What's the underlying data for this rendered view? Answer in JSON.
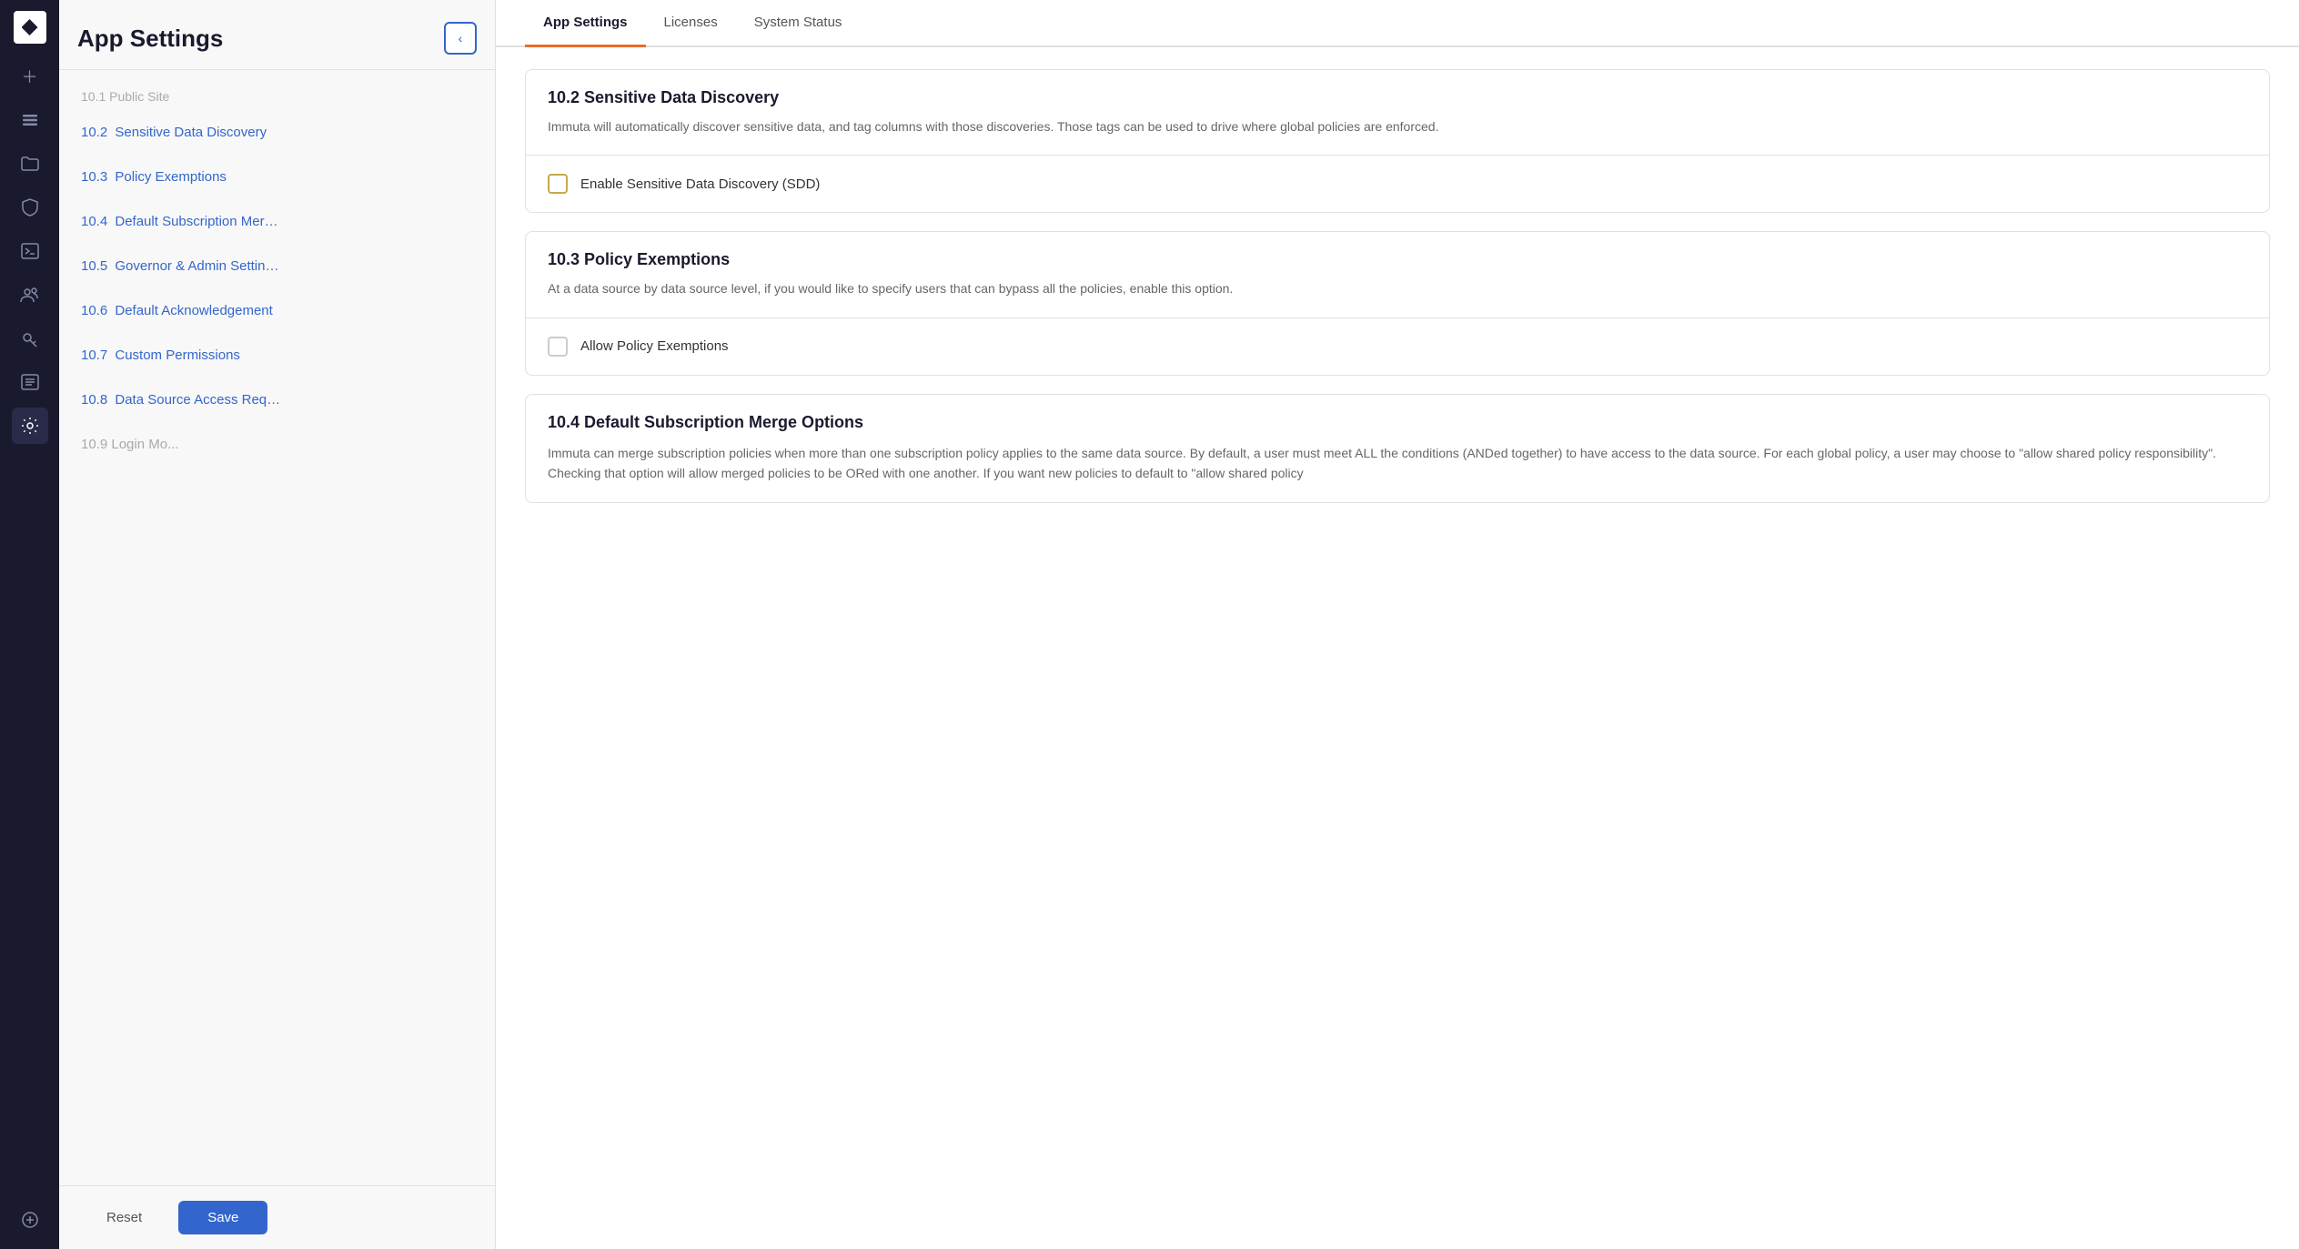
{
  "nav": {
    "logo_label": "I",
    "items": [
      {
        "icon": "➕",
        "name": "add-icon",
        "active": false
      },
      {
        "icon": "≡",
        "name": "layers-icon",
        "active": false
      },
      {
        "icon": "🗂",
        "name": "folder-icon",
        "active": false
      },
      {
        "icon": "🛡",
        "name": "shield-icon",
        "active": false
      },
      {
        "icon": ">_",
        "name": "terminal-icon",
        "active": false
      },
      {
        "icon": "👥",
        "name": "users-icon",
        "active": false
      },
      {
        "icon": "🔑",
        "name": "key-icon",
        "active": false
      },
      {
        "icon": "📋",
        "name": "list-icon",
        "active": false
      },
      {
        "icon": "⚙",
        "name": "settings-icon",
        "active": true
      },
      {
        "icon": "➕",
        "name": "add-bottom-icon",
        "active": false
      }
    ]
  },
  "sidebar": {
    "title": "App Settings",
    "collapse_label": "‹",
    "items": [
      {
        "number": "10.1",
        "label": "Public Site",
        "truncated": false
      },
      {
        "number": "10.2",
        "label": "Sensitive Data Discovery",
        "truncated": false
      },
      {
        "number": "10.3",
        "label": "Policy Exemptions",
        "truncated": false
      },
      {
        "number": "10.4",
        "label": "Default Subscription Mer…",
        "truncated": true
      },
      {
        "number": "10.5",
        "label": "Governor & Admin Settin…",
        "truncated": true
      },
      {
        "number": "10.6",
        "label": "Default Acknowledgement",
        "truncated": false
      },
      {
        "number": "10.7",
        "label": "Custom Permissions",
        "truncated": false
      },
      {
        "number": "10.8",
        "label": "Data Source Access Req…",
        "truncated": true
      },
      {
        "number": "10.9",
        "label": "Login Mo...",
        "truncated": true
      }
    ],
    "reset_label": "Reset",
    "save_label": "Save"
  },
  "tabs": [
    {
      "label": "App Settings",
      "active": true
    },
    {
      "label": "Licenses",
      "active": false
    },
    {
      "label": "System Status",
      "active": false
    }
  ],
  "sections": [
    {
      "id": "10.2",
      "title": "10.2 Sensitive Data Discovery",
      "description": "Immuta will automatically discover sensitive data, and tag columns with those discoveries. Those tags can be used to drive where global policies are enforced.",
      "control_label": "Enable Sensitive Data Discovery (SDD)",
      "checked": false,
      "checkbox_style": "gold"
    },
    {
      "id": "10.3",
      "title": "10.3 Policy Exemptions",
      "description": "At a data source by data source level, if you would like to specify users that can bypass all the policies, enable this option.",
      "control_label": "Allow Policy Exemptions",
      "checked": false,
      "checkbox_style": "default"
    },
    {
      "id": "10.4",
      "title": "10.4 Default Subscription Merge Options",
      "description": "Immuta can merge subscription policies when more than one subscription policy applies to the same data source. By default, a user must meet ALL the conditions (ANDed together) to have access to the data source. For each global policy, a user may choose to \"allow shared policy responsibility\". Checking that option will allow merged policies to be ORed with one another. If you want new policies to default to \"allow shared policy",
      "control_label": null,
      "checked": false,
      "checkbox_style": "default"
    }
  ]
}
